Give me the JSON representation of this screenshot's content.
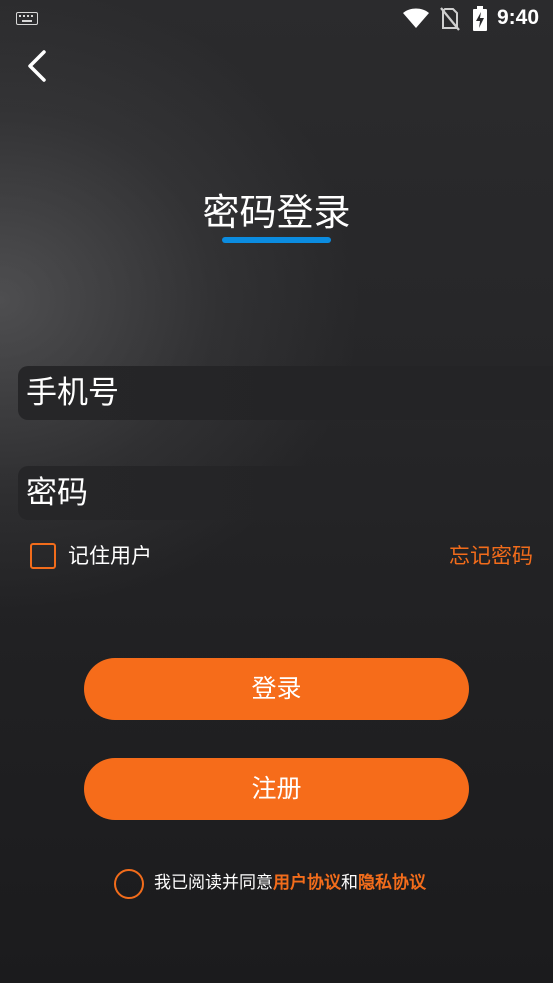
{
  "status_bar": {
    "time": "9:40",
    "icons": [
      "keyboard-icon",
      "wifi-icon",
      "no-sim-icon",
      "battery-charging-icon"
    ]
  },
  "header": {
    "back_icon": "chevron-left-icon",
    "title": "密码登录",
    "underline_color": "#0b8ce0"
  },
  "form": {
    "phone_placeholder": "手机号",
    "password_placeholder": "密码",
    "remember_label": "记住用户",
    "remember_checked": false,
    "forgot_link": "忘记密码"
  },
  "buttons": {
    "login_label": "登录",
    "register_label": "注册"
  },
  "agreement": {
    "checked": false,
    "prefix": "我已阅读并同意",
    "user_agreement": "用户协议",
    "conjunction": "和",
    "privacy_policy": "隐私协议"
  },
  "colors": {
    "accent": "#f66c1a",
    "link": "#f26c1b",
    "title_underline": "#0b8ce0"
  }
}
